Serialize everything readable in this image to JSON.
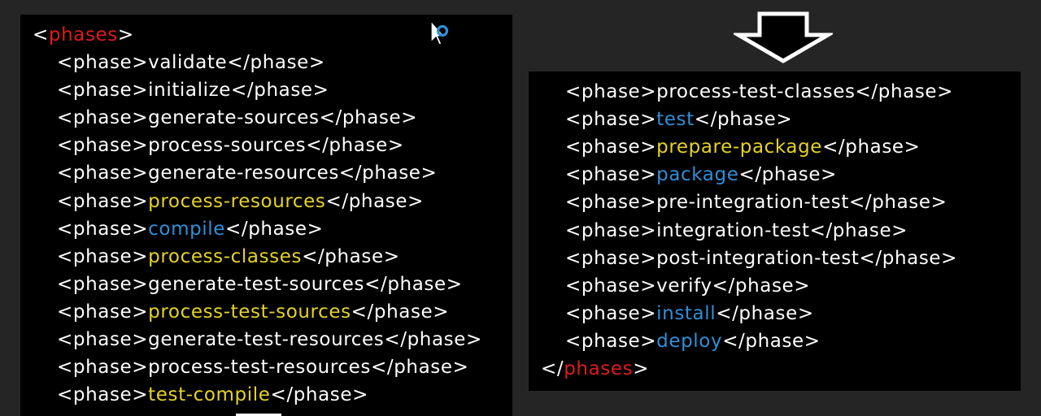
{
  "colors": {
    "background": "#252525",
    "panel": "#000000",
    "tag": "#ffffff",
    "root_name": "#e01b1b",
    "highlight_yellow": "#e6d322",
    "highlight_blue": "#2f8fd8",
    "plain_value": "#ffffff"
  },
  "icons": {
    "down_arrow": "down-arrow-outline-icon",
    "cursor": "busy-pointer-icon"
  },
  "xml": {
    "open_bracket": "<",
    "close_bracket": ">",
    "end_open_bracket": "</",
    "root_tag": "phases",
    "phase_open": "<phase>",
    "phase_close": "</phase>"
  },
  "left_panel": {
    "phases": [
      {
        "name": "validate",
        "color": "white"
      },
      {
        "name": "initialize",
        "color": "white"
      },
      {
        "name": "generate-sources",
        "color": "white"
      },
      {
        "name": "process-sources",
        "color": "white"
      },
      {
        "name": "generate-resources",
        "color": "white"
      },
      {
        "name": "process-resources",
        "color": "yellow"
      },
      {
        "name": "compile",
        "color": "blue"
      },
      {
        "name": "process-classes",
        "color": "yellow"
      },
      {
        "name": "generate-test-sources",
        "color": "white"
      },
      {
        "name": "process-test-sources",
        "color": "yellow"
      },
      {
        "name": "generate-test-resources",
        "color": "white"
      },
      {
        "name": "process-test-resources",
        "color": "white"
      },
      {
        "name": "test-compile",
        "color": "yellow"
      }
    ]
  },
  "right_panel": {
    "phases": [
      {
        "name": "process-test-classes",
        "color": "white"
      },
      {
        "name": "test",
        "color": "blue"
      },
      {
        "name": "prepare-package",
        "color": "yellow"
      },
      {
        "name": "package",
        "color": "blue"
      },
      {
        "name": "pre-integration-test",
        "color": "white"
      },
      {
        "name": "integration-test",
        "color": "white"
      },
      {
        "name": "post-integration-test",
        "color": "white"
      },
      {
        "name": "verify",
        "color": "white"
      },
      {
        "name": "install",
        "color": "blue"
      },
      {
        "name": "deploy",
        "color": "blue"
      }
    ]
  }
}
